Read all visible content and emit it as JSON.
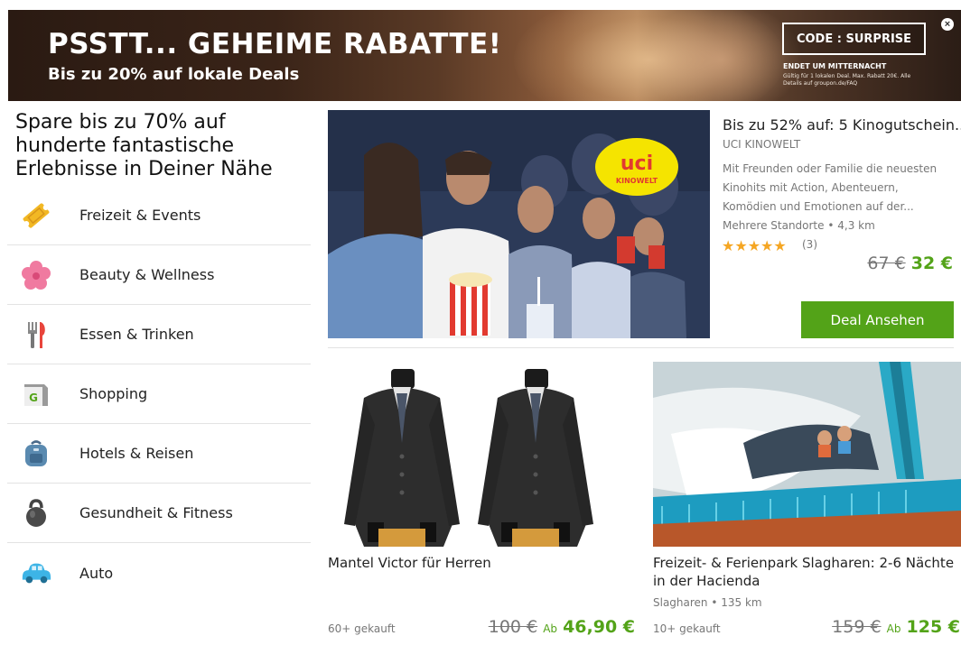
{
  "banner": {
    "headline": "PSSTT... GEHEIME RABATTE!",
    "subline": "Bis zu 20% auf lokale Deals",
    "code_label": "CODE : SURPRISE",
    "ends": "ENDET UM MITTERNACHT",
    "fine_print": "Gültig für 1 lokalen Deal. Max. Rabatt 20€. Alle Details auf groupon.de/FAQ",
    "close_icon": "close-icon"
  },
  "sidebar": {
    "heading": "Spare bis zu 70% auf hunderte fantastische Erlebnisse in Deiner Nähe",
    "categories": [
      {
        "label": "Freizeit & Events",
        "icon": "ticket-icon"
      },
      {
        "label": "Beauty & Wellness",
        "icon": "flower-icon"
      },
      {
        "label": "Essen & Trinken",
        "icon": "cutlery-icon"
      },
      {
        "label": "Shopping",
        "icon": "shopping-bag-icon"
      },
      {
        "label": "Hotels & Reisen",
        "icon": "backpack-icon"
      },
      {
        "label": "Gesundheit & Fitness",
        "icon": "kettlebell-icon"
      },
      {
        "label": "Auto",
        "icon": "car-icon"
      }
    ]
  },
  "featured": {
    "title": "Bis zu 52% auf: 5 Kinogutschein...",
    "merchant": "UCI KINOWELT",
    "description": "Mit Freunden oder Familie die neuesten Kinohits mit Action, Abenteuern, Komödien und Emotionen auf der...",
    "location": "Mehrere Standorte",
    "distance": "• 4,3 km",
    "rating_count": "(3)",
    "rating": 5,
    "price_old": "67 €",
    "price_new": "32 €",
    "button_label": "Deal Ansehen",
    "logo_top": "uci",
    "logo_bottom": "KINOWELT"
  },
  "cards": [
    {
      "title": "Mantel Victor für Herren",
      "bought": "60+ gekauft",
      "price_old": "100 €",
      "ab": "Ab",
      "price_new": "46,90 €"
    },
    {
      "title": "Freizeit- & Ferienpark Slagharen: 2-6 Nächte in der Hacienda",
      "location": "Slagharen",
      "distance": "• 135 km",
      "bought": "10+ gekauft",
      "price_old": "159 €",
      "ab": "Ab",
      "price_new": "125 €"
    }
  ],
  "colors": {
    "accent_green": "#53a318",
    "star": "#f5a623"
  }
}
